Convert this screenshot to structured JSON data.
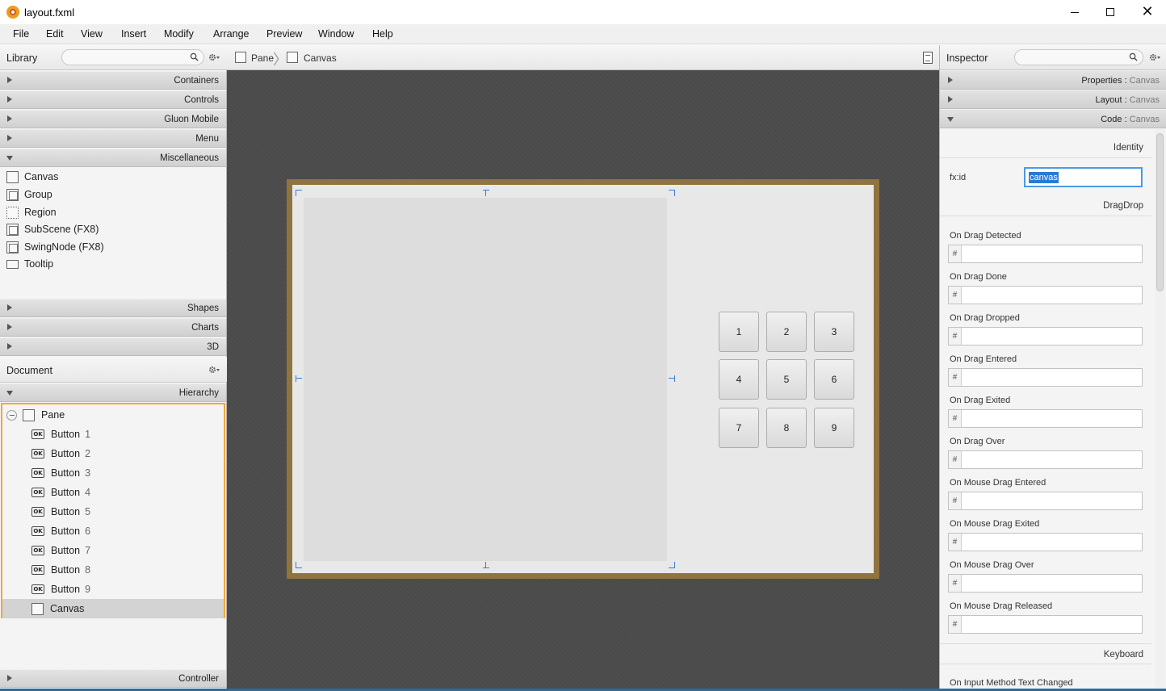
{
  "window": {
    "title": "layout.fxml",
    "minimize_glyph": "",
    "maximize_glyph": "",
    "close_glyph": "✕"
  },
  "menu": [
    "File",
    "Edit",
    "View",
    "Insert",
    "Modify",
    "Arrange",
    "Preview",
    "Window",
    "Help"
  ],
  "library": {
    "title": "Library",
    "search_placeholder": "",
    "sections_top": [
      "Containers",
      "Controls",
      "Gluon Mobile",
      "Menu",
      "Miscellaneous"
    ],
    "misc_items": [
      "Canvas",
      "Group",
      "Region",
      "SubScene  (FX8)",
      "SwingNode  (FX8)",
      "Tooltip"
    ],
    "sections_bottom": [
      "Shapes",
      "Charts",
      "3D"
    ]
  },
  "document": {
    "title": "Document",
    "hierarchy_label": "Hierarchy",
    "root": "Pane",
    "children": [
      {
        "label": "Button",
        "num": "1"
      },
      {
        "label": "Button",
        "num": "2"
      },
      {
        "label": "Button",
        "num": "3"
      },
      {
        "label": "Button",
        "num": "4"
      },
      {
        "label": "Button",
        "num": "5"
      },
      {
        "label": "Button",
        "num": "6"
      },
      {
        "label": "Button",
        "num": "7"
      },
      {
        "label": "Button",
        "num": "8"
      },
      {
        "label": "Button",
        "num": "9"
      }
    ],
    "selected_child": "Canvas",
    "controller_label": "Controller"
  },
  "breadcrumb": {
    "items": [
      "Pane",
      "Canvas"
    ]
  },
  "design_surface": {
    "buttons": [
      "1",
      "2",
      "3",
      "4",
      "5",
      "6",
      "7",
      "8",
      "9"
    ]
  },
  "inspector": {
    "title": "Inspector",
    "search_placeholder": "",
    "sections": [
      {
        "name": "Properties",
        "sub": "Canvas",
        "expanded": false
      },
      {
        "name": "Layout",
        "sub": "Canvas",
        "expanded": false
      },
      {
        "name": "Code",
        "sub": "Canvas",
        "expanded": true
      }
    ],
    "identity_label": "Identity",
    "fxid_label": "fx:id",
    "fxid_value": "canvas",
    "dragdrop_label": "DragDrop",
    "events": [
      "On Drag Detected",
      "On Drag Done",
      "On Drag Dropped",
      "On Drag Entered",
      "On Drag Exited",
      "On Drag Over",
      "On Mouse Drag Entered",
      "On Mouse Drag Exited",
      "On Mouse Drag Over",
      "On Mouse Drag Released"
    ],
    "hash_symbol": "#",
    "keyboard_label": "Keyboard",
    "next_event": "On Input Method Text Changed"
  },
  "colors": {
    "accent_orange": "#f0a93c",
    "pane_border": "#8f7440",
    "selection_blue": "#2a7ad5",
    "workspace_bg": "#4a4a4a"
  }
}
